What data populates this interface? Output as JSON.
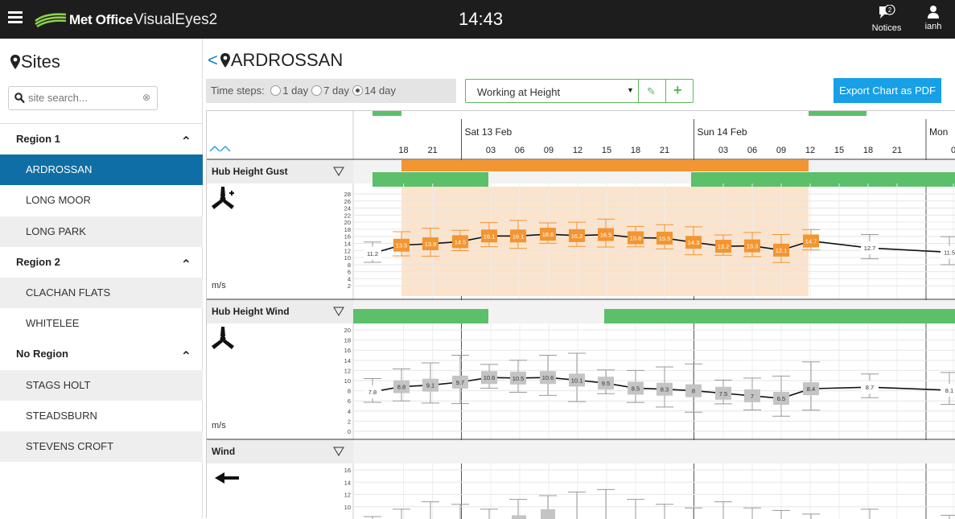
{
  "header": {
    "brand": "Met Office",
    "app_name": "VisualEyes2",
    "clock": "14:43",
    "notices_label": "Notices",
    "notices_count": "2",
    "user_label": "ianh"
  },
  "sidebar": {
    "title": "Sites",
    "search_placeholder": "site search...",
    "items": [
      {
        "type": "region",
        "label": "Region 1"
      },
      {
        "type": "site",
        "label": "ARDROSSAN",
        "active": true
      },
      {
        "type": "site",
        "label": "LONG MOOR"
      },
      {
        "type": "site",
        "label": "LONG PARK"
      },
      {
        "type": "region",
        "label": "Region 2"
      },
      {
        "type": "site",
        "label": "CLACHAN FLATS"
      },
      {
        "type": "site",
        "label": "WHITELEE"
      },
      {
        "type": "region",
        "label": "No Region"
      },
      {
        "type": "site",
        "label": "STAGS HOLT"
      },
      {
        "type": "site",
        "label": "STEADSBURN"
      },
      {
        "type": "site",
        "label": "STEVENS CROFT"
      }
    ]
  },
  "main": {
    "site_name": "ARDROSSAN",
    "timesteps_label": "Time steps:",
    "timesteps": [
      {
        "label": "1 day",
        "selected": false
      },
      {
        "label": "7 day",
        "selected": false
      },
      {
        "label": "14 day",
        "selected": true
      }
    ],
    "profile_value": "Working at Height",
    "export_label": "Export Chart as PDF"
  },
  "timeline": {
    "days": [
      "Sat 13 Feb",
      "Sun 14 Feb",
      "Mon"
    ],
    "hours": [
      "18",
      "21",
      "03",
      "06",
      "09",
      "12",
      "15",
      "18",
      "21",
      "03",
      "06",
      "09",
      "12",
      "15",
      "18",
      "21",
      "0"
    ]
  },
  "panels": [
    {
      "title": "Hub Height Gust",
      "unit": "m/s",
      "icon": "turbine-plus-icon",
      "y_ticks": [
        "28",
        "26",
        "24",
        "22",
        "20",
        "18",
        "16",
        "14",
        "12",
        "10",
        "8",
        "6",
        "4",
        "2"
      ],
      "values": [
        "11.2",
        "13.5",
        "13.9",
        "14.5",
        "16.1",
        "16.1",
        "16.6",
        "16.2",
        "16.5",
        "15.6",
        "15.5",
        "14.3",
        "13.2",
        "13.3",
        "12.1",
        "14.7",
        "12.7",
        "11.5"
      ]
    },
    {
      "title": "Hub Height Wind",
      "unit": "m/s",
      "icon": "turbine-icon",
      "y_ticks": [
        "20",
        "18",
        "16",
        "14",
        "12",
        "10",
        "8",
        "6",
        "4",
        "2",
        "0"
      ],
      "values": [
        "7.8",
        "8.8",
        "9.1",
        "9.7",
        "10.6",
        "10.5",
        "10.6",
        "10.1",
        "9.5",
        "8.5",
        "8.3",
        "8",
        "7.5",
        "7",
        "6.5",
        "8.4",
        "8.7",
        "8.1"
      ]
    },
    {
      "title": "Wind",
      "icon": "arrow-left-icon",
      "y_ticks": [
        "16",
        "14",
        "12",
        "10"
      ]
    }
  ],
  "colors": {
    "accent": "#0f6ea3",
    "export_button": "#18a0e6",
    "ok_green": "#5cbf6a",
    "warn_orange": "#f39530",
    "warn_fill": "#fbe3cc"
  }
}
